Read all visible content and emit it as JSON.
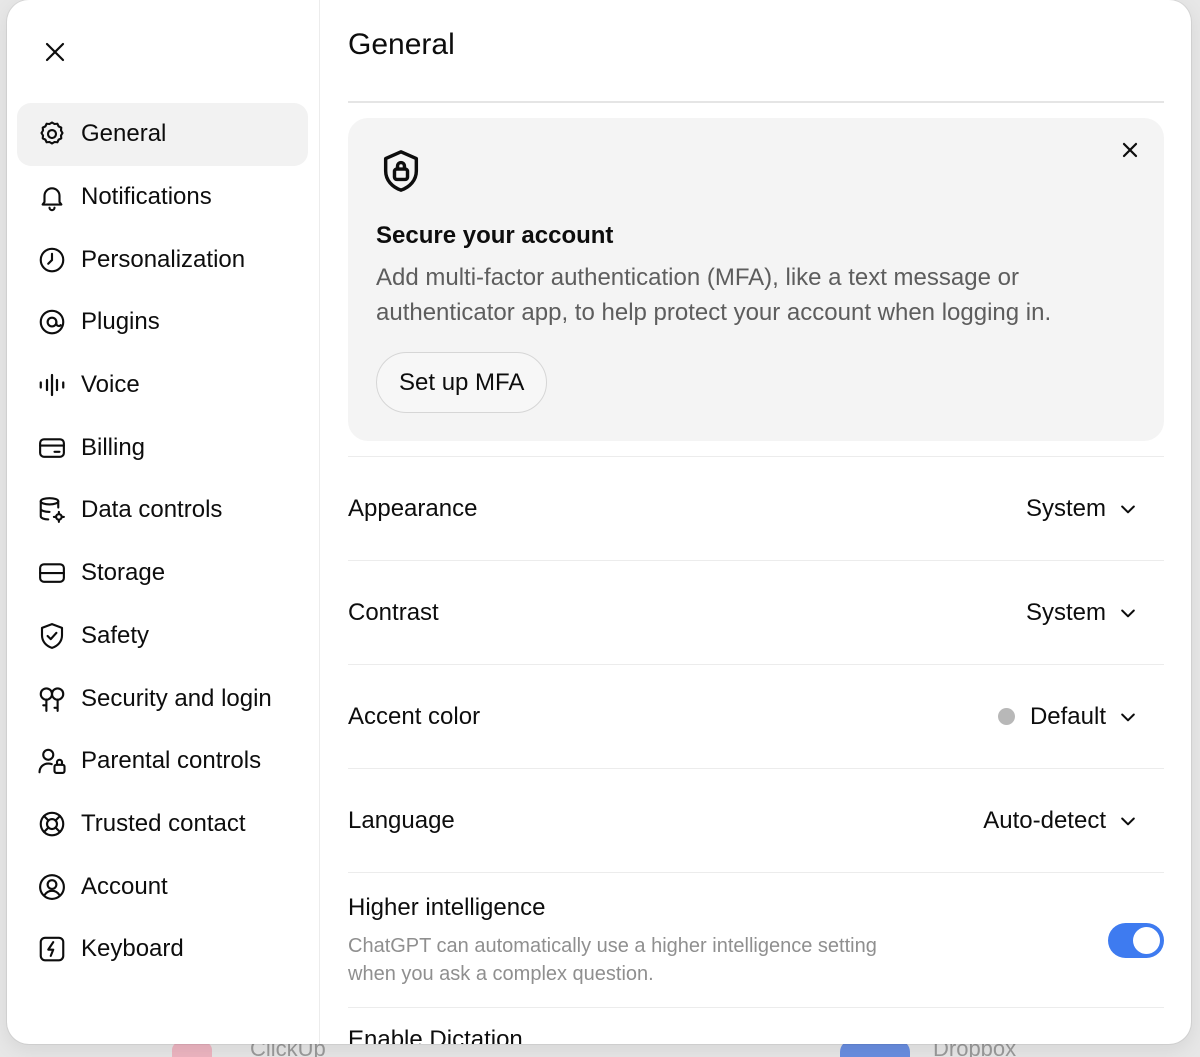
{
  "backdrop": {
    "left_label": "ClickUp",
    "right_label": "Dropbox"
  },
  "sidebar": {
    "items": [
      {
        "label": "General",
        "icon": "gear-icon",
        "active": true
      },
      {
        "label": "Notifications",
        "icon": "bell-icon"
      },
      {
        "label": "Personalization",
        "icon": "personalization-icon"
      },
      {
        "label": "Plugins",
        "icon": "plugins-icon"
      },
      {
        "label": "Voice",
        "icon": "voice-waveform-icon"
      },
      {
        "label": "Billing",
        "icon": "credit-card-icon"
      },
      {
        "label": "Data controls",
        "icon": "database-gear-icon"
      },
      {
        "label": "Storage",
        "icon": "storage-drive-icon"
      },
      {
        "label": "Safety",
        "icon": "shield-check-icon"
      },
      {
        "label": "Security and login",
        "icon": "security-key-icon"
      },
      {
        "label": "Parental controls",
        "icon": "parent-lock-icon"
      },
      {
        "label": "Trusted contact",
        "icon": "lifebuoy-icon"
      },
      {
        "label": "Account",
        "icon": "user-circle-icon"
      },
      {
        "label": "Keyboard",
        "icon": "keyboard-bolt-icon"
      }
    ]
  },
  "main": {
    "title": "General",
    "mfa_card": {
      "icon": "shield-lock-icon",
      "title": "Secure your account",
      "description": "Add multi-factor authentication (MFA), like a text message or authenticator app, to help protect your account when logging in.",
      "button_label": "Set up MFA"
    },
    "settings": {
      "appearance": {
        "label": "Appearance",
        "value": "System"
      },
      "contrast": {
        "label": "Contrast",
        "value": "System"
      },
      "accent_color": {
        "label": "Accent color",
        "value": "Default",
        "dot_color": "#b8b8b8"
      },
      "language": {
        "label": "Language",
        "value": "Auto-detect"
      }
    },
    "higher_intelligence": {
      "title": "Higher intelligence",
      "description": "ChatGPT can automatically use a higher intelligence setting when you ask a complex question.",
      "enabled": true,
      "toggle_color": "#3e7bf0"
    },
    "next_row_label": "Enable Dictation"
  }
}
